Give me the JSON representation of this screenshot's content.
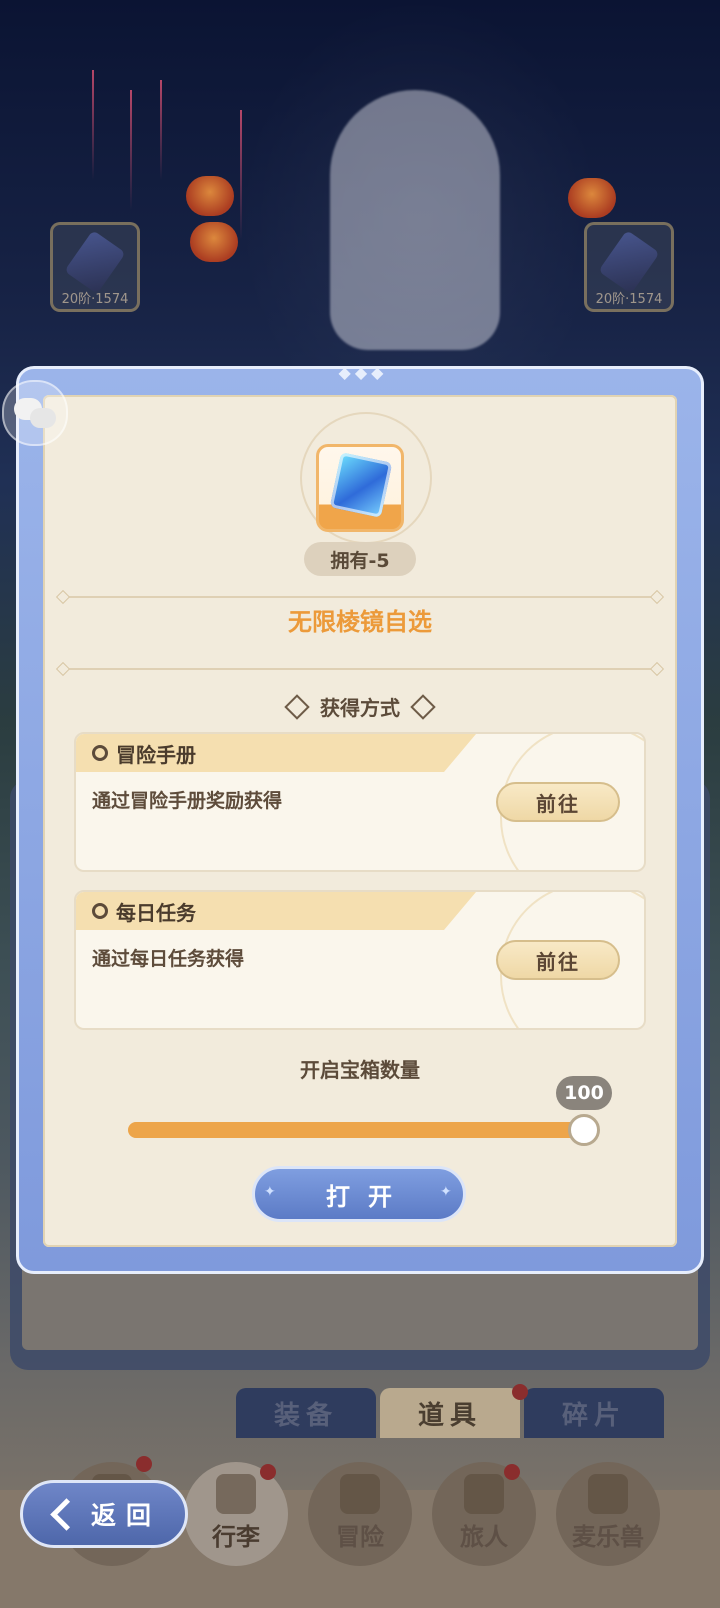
{
  "background": {
    "equip_slots": [
      {
        "level": "20阶·1574"
      },
      {
        "level": "20阶·1574"
      }
    ]
  },
  "dialog": {
    "owned_label": "拥有-5",
    "item_name": "无限棱镜自选",
    "section_heading": "获得方式",
    "sources": [
      {
        "title": "冒险手册",
        "description": "通过冒险手册奖励获得",
        "button_label": "前往"
      },
      {
        "title": "每日任务",
        "description": "通过每日任务获得",
        "button_label": "前往"
      }
    ],
    "quantity_label": "开启宝箱数量",
    "quantity": {
      "value": "100",
      "fill_fraction": 1.0
    },
    "open_button_label": "打开"
  },
  "bag_tabs": [
    {
      "label": "装备",
      "active": false
    },
    {
      "label": "道具",
      "active": true
    },
    {
      "label": "碎片",
      "active": false
    }
  ],
  "bottom_nav": [
    {
      "label": "",
      "active": false
    },
    {
      "label": "行李",
      "active": true
    },
    {
      "label": "冒险",
      "active": false
    },
    {
      "label": "旅人",
      "active": false
    },
    {
      "label": "麦乐兽",
      "active": false
    }
  ],
  "back_button_label": "返回",
  "colors": {
    "accent_orange": "#eda54a",
    "dialog_frame_blue": "#8fa9e6",
    "panel_cream": "#f2ebdc"
  },
  "icons": {
    "chat": "chat-bubbles-icon",
    "item": "prism-cube-icon",
    "back": "back-arrow-icon"
  }
}
